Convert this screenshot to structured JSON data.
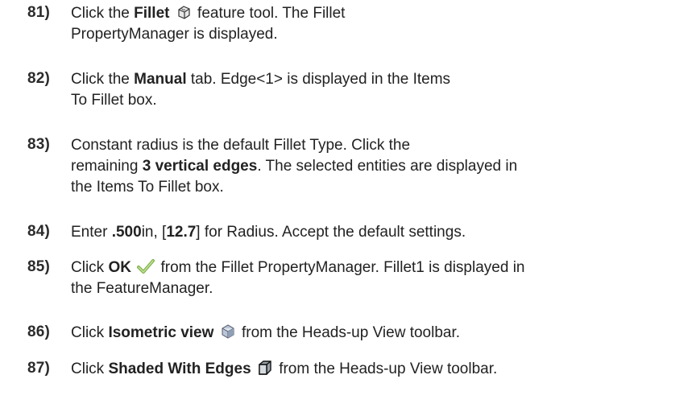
{
  "steps": [
    {
      "number": "81)",
      "line1": {
        "pre": "Click the ",
        "bold": "Fillet",
        "post": " feature tool. The Fillet"
      },
      "line2": "PropertyManager is displayed.",
      "icon": "fillet-feature-icon"
    },
    {
      "number": "82)",
      "line1": {
        "pre": "Click the ",
        "bold": "Manual",
        "post": " tab. Edge<1> is displayed in the Items"
      },
      "line2": "To Fillet box."
    },
    {
      "number": "83)",
      "line1": "Constant radius is the default Fillet Type. Click the",
      "line2": {
        "pre": "remaining ",
        "bold": "3 vertical edges",
        "post": ". The selected entities are displayed in"
      },
      "line3": "the Items To Fillet box."
    },
    {
      "number": "84)",
      "line1": {
        "pre": "Enter ",
        "bold1": ".500",
        "mid": "in, [",
        "bold2": "12.7",
        "post": "] for Radius. Accept the default settings."
      }
    },
    {
      "number": "85)",
      "line1": {
        "pre": "Click ",
        "bold": "OK",
        "post": " from the Fillet PropertyManager. Fillet1 is displayed in"
      },
      "line2": "the FeatureManager.",
      "icon": "ok-checkmark-icon"
    },
    {
      "number": "86)",
      "line1": {
        "pre": "Click ",
        "bold": "Isometric view",
        "post": " from the Heads-up View toolbar."
      },
      "icon": "isometric-view-icon"
    },
    {
      "number": "87)",
      "line1": {
        "pre": "Click ",
        "bold": "Shaded With Edges",
        "post": " from the Heads-up View toolbar."
      },
      "icon": "shaded-with-edges-icon"
    }
  ]
}
